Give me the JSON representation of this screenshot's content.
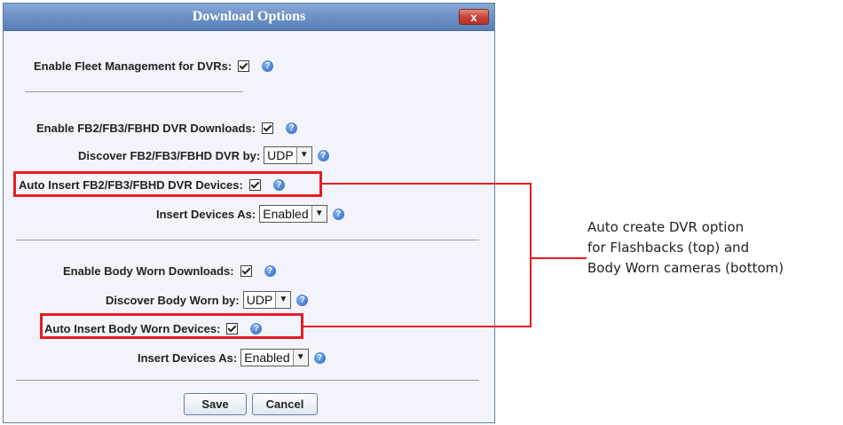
{
  "dialog": {
    "title": "Download Options",
    "close_label": "x"
  },
  "fleet": {
    "label": "Enable Fleet Management for DVRs:",
    "checked": true
  },
  "fb": {
    "enable_label": "Enable FB2/FB3/FBHD DVR Downloads:",
    "discover_label": "Discover FB2/FB3/FBHD DVR by:",
    "discover_value": "UDP",
    "auto_insert_label": "Auto Insert FB2/FB3/FBHD DVR Devices:",
    "insert_as_label": "Insert Devices As:",
    "insert_as_value": "Enabled"
  },
  "body": {
    "enable_label": "Enable Body Worn Downloads:",
    "discover_label": "Discover Body Worn by:",
    "discover_value": "UDP",
    "auto_insert_label": "Auto Insert Body Worn Devices:",
    "insert_as_label": "Insert Devices As:",
    "insert_as_value": "Enabled"
  },
  "buttons": {
    "save": "Save",
    "cancel": "Cancel"
  },
  "annotation": {
    "line1": "Auto create DVR option",
    "line2": "for Flashbacks (top) and",
    "line3": "Body Worn cameras (bottom)"
  },
  "colors": {
    "highlight": "#e41d25",
    "titlebar": "#6f92c7"
  }
}
